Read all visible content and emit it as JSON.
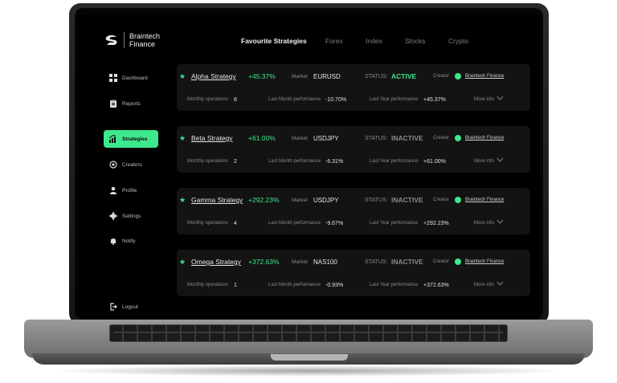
{
  "app": {
    "name_line1": "Braintech",
    "name_line2": "Finance"
  },
  "topnav": [
    {
      "label": "Favourite Strategies",
      "active": true
    },
    {
      "label": "Forex",
      "active": false
    },
    {
      "label": "Index",
      "active": false
    },
    {
      "label": "Stocks",
      "active": false
    },
    {
      "label": "Crypto",
      "active": false
    }
  ],
  "sidebar": {
    "items": [
      {
        "label": "Dashboard",
        "icon": "grid-icon"
      },
      {
        "label": "Reports",
        "icon": "clipboard-icon"
      },
      {
        "label": "Strategies",
        "icon": "bar-chart-icon",
        "active": true
      },
      {
        "label": "Creators",
        "icon": "target-icon"
      },
      {
        "label": "Profile",
        "icon": "user-icon"
      },
      {
        "label": "Settings",
        "icon": "gear-icon"
      },
      {
        "label": "Notify",
        "icon": "bell-icon"
      }
    ],
    "logout": {
      "label": "Logout",
      "icon": "logout-icon"
    }
  },
  "labels": {
    "market": "Market",
    "status": "STATUS:",
    "creator": "Creator",
    "monthly_ops": "Monthly operations",
    "last_month": "Last Month performance",
    "last_year": "Last Year performance",
    "more_info": "More info"
  },
  "strategies": [
    {
      "name": "Alpha Strategy",
      "gain": "+45.37%",
      "market": "EURUSD",
      "status": "ACTIVE",
      "creator": "Braintech Finance",
      "monthly_ops": "8",
      "last_month": "-10.70%",
      "last_year": "+45.37%"
    },
    {
      "name": "Beta Strategy",
      "gain": "+61.00%",
      "market": "USDJPY",
      "status": "INACTIVE",
      "creator": "Braintech Finance",
      "monthly_ops": "2",
      "last_month": "-6.31%",
      "last_year": "+61.00%"
    },
    {
      "name": "Gamma Strategy",
      "gain": "+292.23%",
      "market": "USDJPY",
      "status": "INACTIVE",
      "creator": "Braintech Finance",
      "monthly_ops": "4",
      "last_month": "-9.67%",
      "last_year": "+292.23%"
    },
    {
      "name": "Omega Strategy",
      "gain": "+372.63%",
      "market": "NAS100",
      "status": "INACTIVE",
      "creator": "Braintech Finance",
      "monthly_ops": "1",
      "last_month": "-0.93%",
      "last_year": "+372.63%"
    }
  ],
  "colors": {
    "accent": "#3ee88d",
    "background": "#000000",
    "card": "#131313"
  }
}
